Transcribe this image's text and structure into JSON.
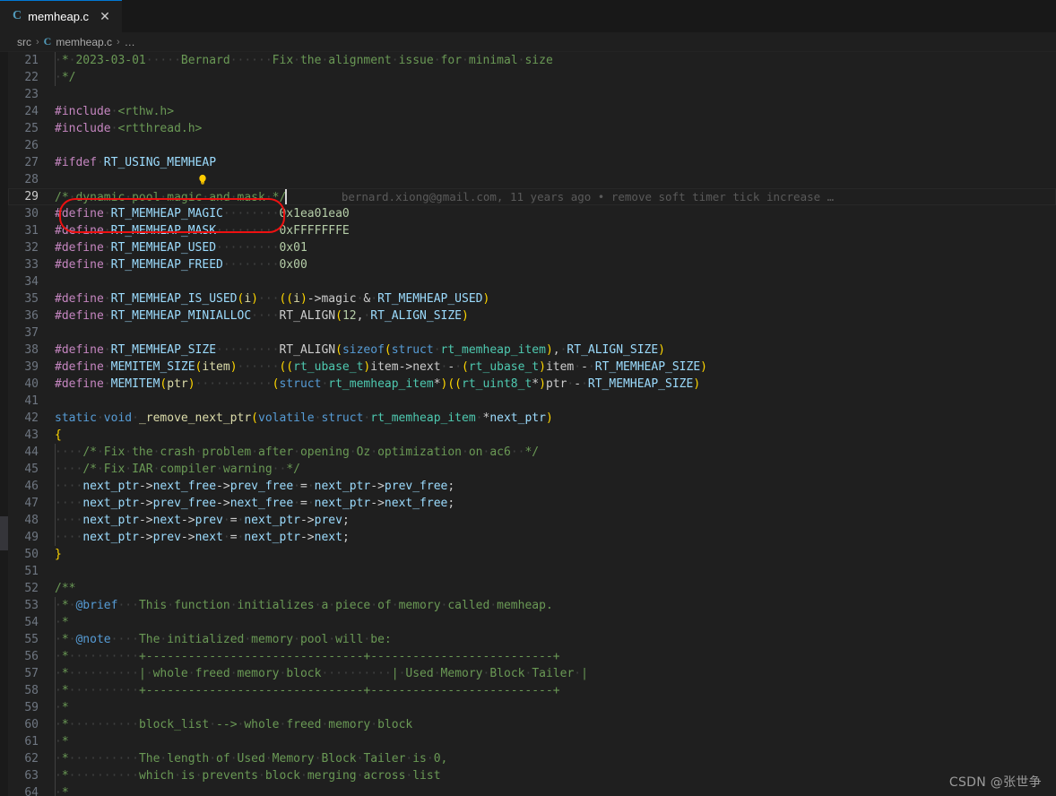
{
  "window": {
    "background": "#1f1f1f",
    "accent": "#0078d4"
  },
  "tab": {
    "filetype_icon": "c-file-icon",
    "filetype_letter": "C",
    "label": "memheap.c",
    "close_glyph": "✕"
  },
  "breadcrumb": {
    "items": [
      "src",
      "memheap.c",
      "…"
    ],
    "separator": "›",
    "file_icon_letter": "C"
  },
  "editor": {
    "active_line": 29,
    "blame": "bernard.xiong@gmail.com, 11 years ago • remove soft timer tick increase …",
    "lightbulb_line": 28,
    "annotation": {
      "shape": "red-ellipse",
      "color": "#ee1111",
      "targets_line": 27
    },
    "lines": [
      {
        "n": 21
      },
      {
        "n": 22
      },
      {
        "n": 23
      },
      {
        "n": 24
      },
      {
        "n": 25
      },
      {
        "n": 26
      },
      {
        "n": 27
      },
      {
        "n": 28
      },
      {
        "n": 29
      },
      {
        "n": 30
      },
      {
        "n": 31
      },
      {
        "n": 32
      },
      {
        "n": 33
      },
      {
        "n": 34
      },
      {
        "n": 35
      },
      {
        "n": 36
      },
      {
        "n": 37
      },
      {
        "n": 38
      },
      {
        "n": 39
      },
      {
        "n": 40
      },
      {
        "n": 41
      },
      {
        "n": 42
      },
      {
        "n": 43
      },
      {
        "n": 44
      },
      {
        "n": 45
      },
      {
        "n": 46
      },
      {
        "n": 47
      },
      {
        "n": 48
      },
      {
        "n": 49
      },
      {
        "n": 50
      },
      {
        "n": 51
      },
      {
        "n": 52
      },
      {
        "n": 53
      },
      {
        "n": 54
      },
      {
        "n": 55
      },
      {
        "n": 56
      },
      {
        "n": 57
      },
      {
        "n": 58
      },
      {
        "n": 59
      },
      {
        "n": 60
      },
      {
        "n": 61
      },
      {
        "n": 62
      },
      {
        "n": 63
      },
      {
        "n": 64
      }
    ],
    "code": {
      "l21": " * 2023-03-01     Bernard      Fix the alignment issue for minimal size",
      "l22": " */",
      "l23": "",
      "l24": "#include <rthw.h>",
      "l25": "#include <rtthread.h>",
      "l26": "",
      "l27": "#ifdef RT_USING_MEMHEAP",
      "l28": "",
      "l29": "/* dynamic pool magic and mask */",
      "l30": "#define RT_MEMHEAP_MAGIC        0x1ea01ea0",
      "l31": "#define RT_MEMHEAP_MASK         0xFFFFFFFE",
      "l32": "#define RT_MEMHEAP_USED         0x01",
      "l33": "#define RT_MEMHEAP_FREED        0x00",
      "l34": "",
      "l35": "#define RT_MEMHEAP_IS_USED(i)   ((i)->magic & RT_MEMHEAP_USED)",
      "l36": "#define RT_MEMHEAP_MINIALLOC    RT_ALIGN(12, RT_ALIGN_SIZE)",
      "l37": "",
      "l38": "#define RT_MEMHEAP_SIZE         RT_ALIGN(sizeof(struct rt_memheap_item), RT_ALIGN_SIZE)",
      "l39": "#define MEMITEM_SIZE(item)      ((rt_ubase_t)item->next - (rt_ubase_t)item - RT_MEMHEAP_SIZE)",
      "l40": "#define MEMITEM(ptr)            (struct rt_memheap_item*)((rt_uint8_t*)ptr - RT_MEMHEAP_SIZE)",
      "l41": "",
      "l42": "static void _remove_next_ptr(volatile struct rt_memheap_item *next_ptr)",
      "l43": "{",
      "l44": "    /* Fix the crash problem after opening Oz optimization on ac6  */",
      "l45": "    /* Fix IAR compiler warning  */",
      "l46": "    next_ptr->next_free->prev_free = next_ptr->prev_free;",
      "l47": "    next_ptr->prev_free->next_free = next_ptr->next_free;",
      "l48": "    next_ptr->next->prev = next_ptr->prev;",
      "l49": "    next_ptr->prev->next = next_ptr->next;",
      "l50": "}",
      "l51": "",
      "l52": "/**",
      "l53": " * @brief   This function initializes a piece of memory called memheap.",
      "l54": " *",
      "l55": " * @note    The initialized memory pool will be:",
      "l56": " *          +-------------------------------+--------------------------+",
      "l57": " *          | whole freed memory block      | Used Memory Block Tailer |",
      "l58": " *          +-------------------------------+--------------------------+",
      "l59": " *",
      "l60": " *          block_list --> whole freed memory block",
      "l61": " *",
      "l62": " *          The length of Used Memory Block Tailer is 0,",
      "l63": " *          which is prevents block merging across list",
      "l64": " *"
    }
  },
  "watermark": {
    "text": "CSDN @张世争"
  }
}
